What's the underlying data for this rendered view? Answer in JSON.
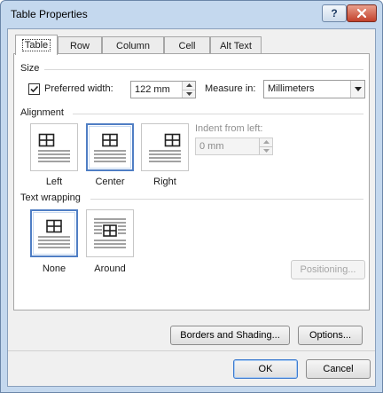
{
  "window": {
    "title": "Table Properties",
    "help_label": "?"
  },
  "tabs": [
    {
      "label": "Table",
      "active": true
    },
    {
      "label": "Row",
      "active": false
    },
    {
      "label": "Column",
      "active": false
    },
    {
      "label": "Cell",
      "active": false
    },
    {
      "label": "Alt Text",
      "active": false
    }
  ],
  "size": {
    "group_label": "Size",
    "preferred_width_label": "Preferred width:",
    "preferred_width_checked": true,
    "preferred_width_value": "122 mm",
    "measure_in_label": "Measure in:",
    "measure_in_value": "Millimeters"
  },
  "alignment": {
    "group_label": "Alignment",
    "options": [
      {
        "label": "Left",
        "selected": false
      },
      {
        "label": "Center",
        "selected": true
      },
      {
        "label": "Right",
        "selected": false
      }
    ],
    "indent_label": "Indent from left:",
    "indent_value": "0 mm"
  },
  "text_wrapping": {
    "group_label": "Text wrapping",
    "options": [
      {
        "label": "None",
        "selected": true
      },
      {
        "label": "Around",
        "selected": false
      }
    ],
    "positioning_label": "Positioning..."
  },
  "buttons": {
    "borders_shading": "Borders and Shading...",
    "options": "Options...",
    "ok": "OK",
    "cancel": "Cancel"
  },
  "colors": {
    "title_bar": "#c4d8ee",
    "close_button": "#c2412b",
    "selection_border": "#4f7ec4",
    "dialog_background": "#f0f0f0"
  },
  "icons": {
    "help": "question-mark-icon",
    "close": "close-x-icon",
    "check": "checkmark-icon",
    "spin": "spin-arrows-icon",
    "dropdown": "chevron-down-icon",
    "align_left": "table-align-left-icon",
    "align_center": "table-align-center-icon",
    "align_right": "table-align-right-icon",
    "wrap_none": "wrap-none-icon",
    "wrap_around": "wrap-around-icon"
  }
}
